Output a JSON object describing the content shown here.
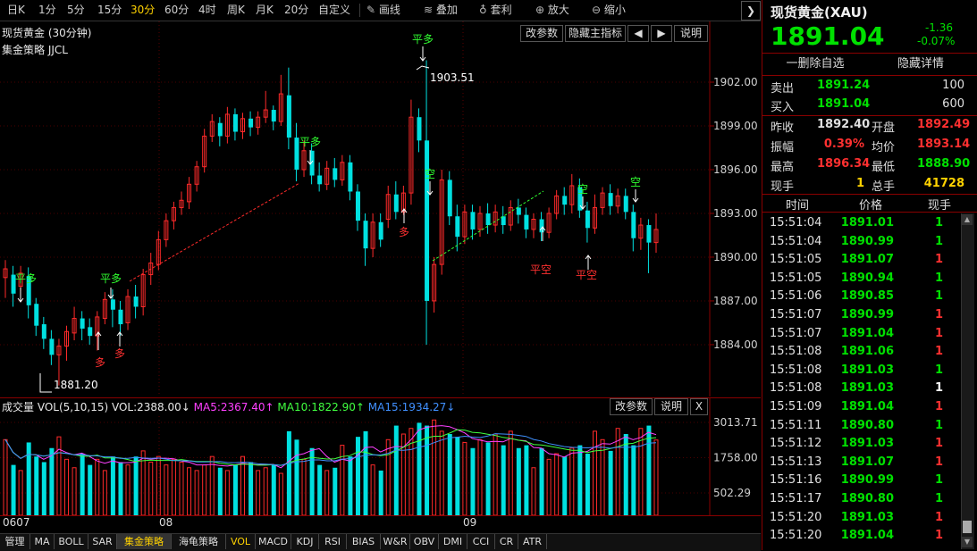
{
  "toolbar": {
    "periods": [
      "日K",
      "1分",
      "5分",
      "15分",
      "30分",
      "60分",
      "4时",
      "周K",
      "月K",
      "20分",
      "自定义"
    ],
    "active_period": "30分",
    "tools": [
      "画线",
      "叠加",
      "套利",
      "放大",
      "缩小"
    ]
  },
  "chart": {
    "title": "现货黄金 (30分钟)",
    "strategy": "集金策略 JJCL",
    "buttons": [
      "改参数",
      "隐藏主指标",
      "◀",
      "▶",
      "说明"
    ],
    "y_labels": [
      "1902.00",
      "1899.00",
      "1896.00",
      "1893.00",
      "1890.00",
      "1887.00",
      "1884.00"
    ],
    "high_label": "1903.51",
    "low_label": "1881.20",
    "signals": {
      "ping_duo": "平多",
      "duo": "多",
      "kong": "空",
      "ping_kong": "平空"
    }
  },
  "volume": {
    "title": "成交量",
    "indicator": "VOL(5,10,15)",
    "vol": "VOL:2388.00↓",
    "ma5": "MA5:2367.40↑",
    "ma10": "MA10:1822.90↑",
    "ma15": "MA15:1934.27↓",
    "buttons": [
      "改参数",
      "说明",
      "X"
    ],
    "y_labels": [
      "3013.71",
      "1758.00",
      "502.29"
    ]
  },
  "date_axis": [
    "0607",
    "08",
    "09"
  ],
  "bottom_tabs": [
    "管理",
    "MA",
    "BOLL",
    "SAR",
    "集金策略",
    "海龟策略",
    "VOL",
    "MACD",
    "KDJ",
    "RSI",
    "BIAS",
    "W&R",
    "OBV",
    "DMI",
    "CCI",
    "CR",
    "ATR"
  ],
  "selected_tab": "集金策略",
  "quote": {
    "title": "现货黄金(XAU)",
    "price": "1891.04",
    "change": "-1.36",
    "change_pct": "-0.07%",
    "delete_watch": "一删除自选",
    "hide_detail": "隐藏详情",
    "sell_label": "卖出",
    "sell_price": "1891.24",
    "sell_vol": "100",
    "buy_label": "买入",
    "buy_price": "1891.04",
    "buy_vol": "600",
    "stats": [
      {
        "l1": "昨收",
        "v1": "1892.40",
        "l2": "开盘",
        "v2": "1892.49"
      },
      {
        "l1": "振幅",
        "v1": "0.39%",
        "l2": "均价",
        "v2": "1893.14"
      },
      {
        "l1": "最高",
        "v1": "1896.34",
        "l2": "最低",
        "v2": "1888.90"
      },
      {
        "l1": "现手",
        "v1": "1",
        "l2": "总手",
        "v2": "41728"
      }
    ],
    "trade_headers": [
      "时间",
      "价格",
      "现手"
    ],
    "trades": [
      [
        "15:51:04",
        "1891.01",
        "1"
      ],
      [
        "15:51:04",
        "1890.99",
        "1"
      ],
      [
        "15:51:05",
        "1891.07",
        "1"
      ],
      [
        "15:51:05",
        "1890.94",
        "1"
      ],
      [
        "15:51:06",
        "1890.85",
        "1"
      ],
      [
        "15:51:07",
        "1890.99",
        "1"
      ],
      [
        "15:51:07",
        "1891.04",
        "1"
      ],
      [
        "15:51:08",
        "1891.06",
        "1"
      ],
      [
        "15:51:08",
        "1891.03",
        "1"
      ],
      [
        "15:51:08",
        "1891.03",
        "1"
      ],
      [
        "15:51:09",
        "1891.04",
        "1"
      ],
      [
        "15:51:11",
        "1890.80",
        "1"
      ],
      [
        "15:51:12",
        "1891.03",
        "1"
      ],
      [
        "15:51:13",
        "1891.07",
        "1"
      ],
      [
        "15:51:16",
        "1890.99",
        "1"
      ],
      [
        "15:51:17",
        "1890.80",
        "1"
      ],
      [
        "15:51:20",
        "1891.03",
        "1"
      ],
      [
        "15:51:20",
        "1891.04",
        "1"
      ]
    ],
    "trade_vol_colors": [
      "#00e000",
      "#00e000",
      "#ff3030",
      "#00e000",
      "#00e000",
      "#ff3030",
      "#ff3030",
      "#ff3030",
      "#00e000",
      "#ffffff",
      "#ff3030",
      "#00e000",
      "#ff3030",
      "#ff3030",
      "#00e000",
      "#00e000",
      "#ff3030",
      "#ff3030"
    ]
  },
  "colors": {
    "up": "#ff2a2a",
    "down": "#00e0e0",
    "green_text": "#00e000",
    "red_text": "#ff3030",
    "accent": "#ffd200"
  }
}
